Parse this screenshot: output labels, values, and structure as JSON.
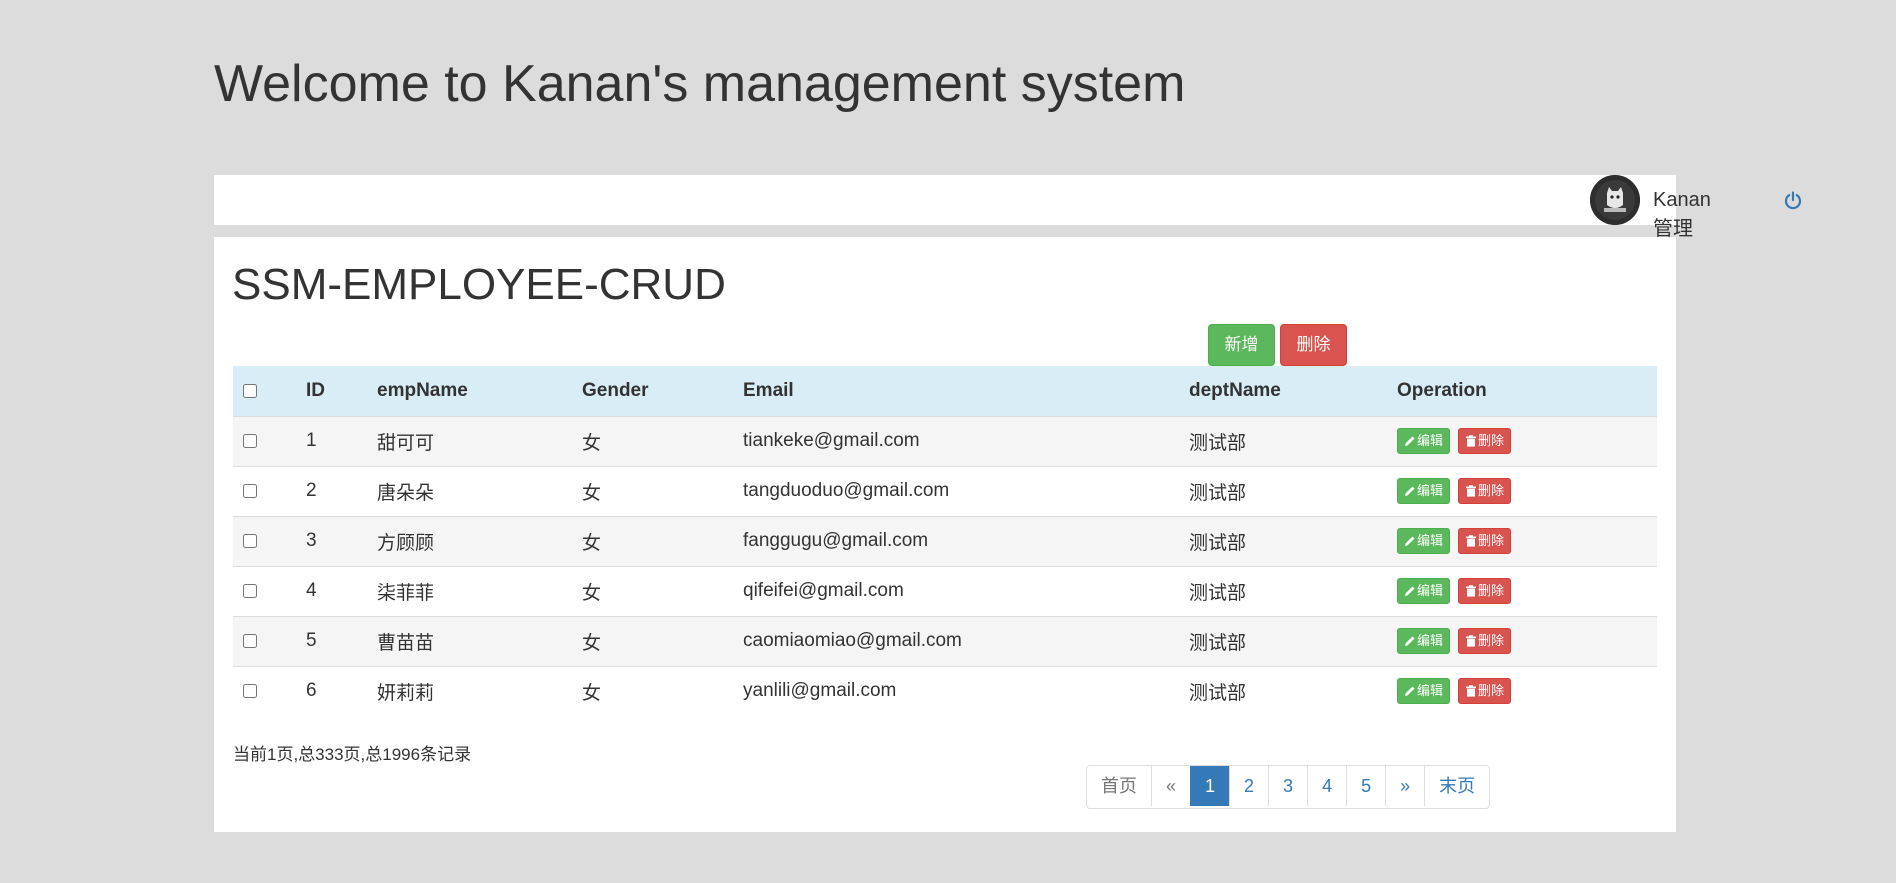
{
  "header": {
    "welcome": "Welcome to Kanan's management system"
  },
  "userbar": {
    "username": "Kanan管理员",
    "avatar_icon": "cat-avatar",
    "logout_icon": "power-icon"
  },
  "panel": {
    "title": "SSM-EMPLOYEE-CRUD",
    "add_label": "新增",
    "delete_label": "删除"
  },
  "table": {
    "columns": [
      "ID",
      "empName",
      "Gender",
      "Email",
      "deptName",
      "Operation"
    ],
    "rows": [
      {
        "id": "1",
        "name": "甜可可",
        "gender": "女",
        "email": "tiankeke@gmail.com",
        "dept": "测试部"
      },
      {
        "id": "2",
        "name": "唐朵朵",
        "gender": "女",
        "email": "tangduoduo@gmail.com",
        "dept": "测试部"
      },
      {
        "id": "3",
        "name": "方顾顾",
        "gender": "女",
        "email": "fanggugu@gmail.com",
        "dept": "测试部"
      },
      {
        "id": "4",
        "name": "柒菲菲",
        "gender": "女",
        "email": "qifeifei@gmail.com",
        "dept": "测试部"
      },
      {
        "id": "5",
        "name": "曹苗苗",
        "gender": "女",
        "email": "caomiaomiao@gmail.com",
        "dept": "测试部"
      },
      {
        "id": "6",
        "name": "妍莉莉",
        "gender": "女",
        "email": "yanlili@gmail.com",
        "dept": "测试部"
      }
    ],
    "edit_label": "编辑",
    "delete_label": "删除"
  },
  "pagination": {
    "info": "当前1页,总333页,总1996条记录",
    "first": "首页",
    "prev": "«",
    "pages": [
      "1",
      "2",
      "3",
      "4",
      "5"
    ],
    "next": "»",
    "last": "末页",
    "current": "1"
  },
  "colors": {
    "success": "#5cb85c",
    "danger": "#d9534f",
    "primary": "#337ab7",
    "header_row": "#d9edf7"
  }
}
